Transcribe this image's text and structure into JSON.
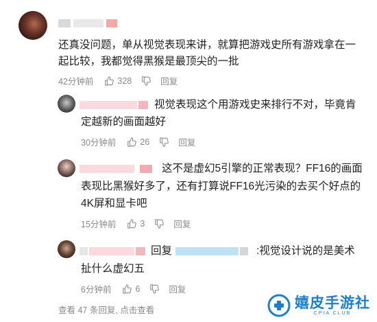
{
  "main_comment": {
    "text": "还真没问题，单从视觉表现来讲，就算把游戏史所有游戏拿在一起比较，我都觉得黑猴是最顶尖的一批",
    "time": "42分钟前",
    "likes": "328",
    "reply_label": "回复"
  },
  "replies": [
    {
      "text_line1": "视觉表现这个用游戏史来排行不对，毕竟肯",
      "text_line2": "定越新的画面越好",
      "time": "30分钟前",
      "likes": "26",
      "reply_label": "回复"
    },
    {
      "text_line1": "这不是虚幻5引擎的正常表现？FF16的画面",
      "text_line2": "表现比黑猴好多了，还有打算说FF16光污染的去买个好点的",
      "text_line3": "4K屏和显卡吧",
      "time": "15分钟前",
      "likes": "3",
      "reply_label": "回复"
    },
    {
      "reply_prefix": "回复",
      "text_line1": ":视觉设计说的是美术",
      "text_line2": "扯什么虚幻五",
      "time": "6分钟前",
      "likes": "6",
      "reply_label": "回复"
    }
  ],
  "view_more": "查看 47 条回复, 点击查看",
  "watermark": {
    "name": "嬉皮手游社",
    "sub": "CPIA CLUB",
    "color": "#1a7fd1"
  },
  "colors": {
    "meta_text": "#8a8a8a",
    "body_text": "#222222"
  }
}
